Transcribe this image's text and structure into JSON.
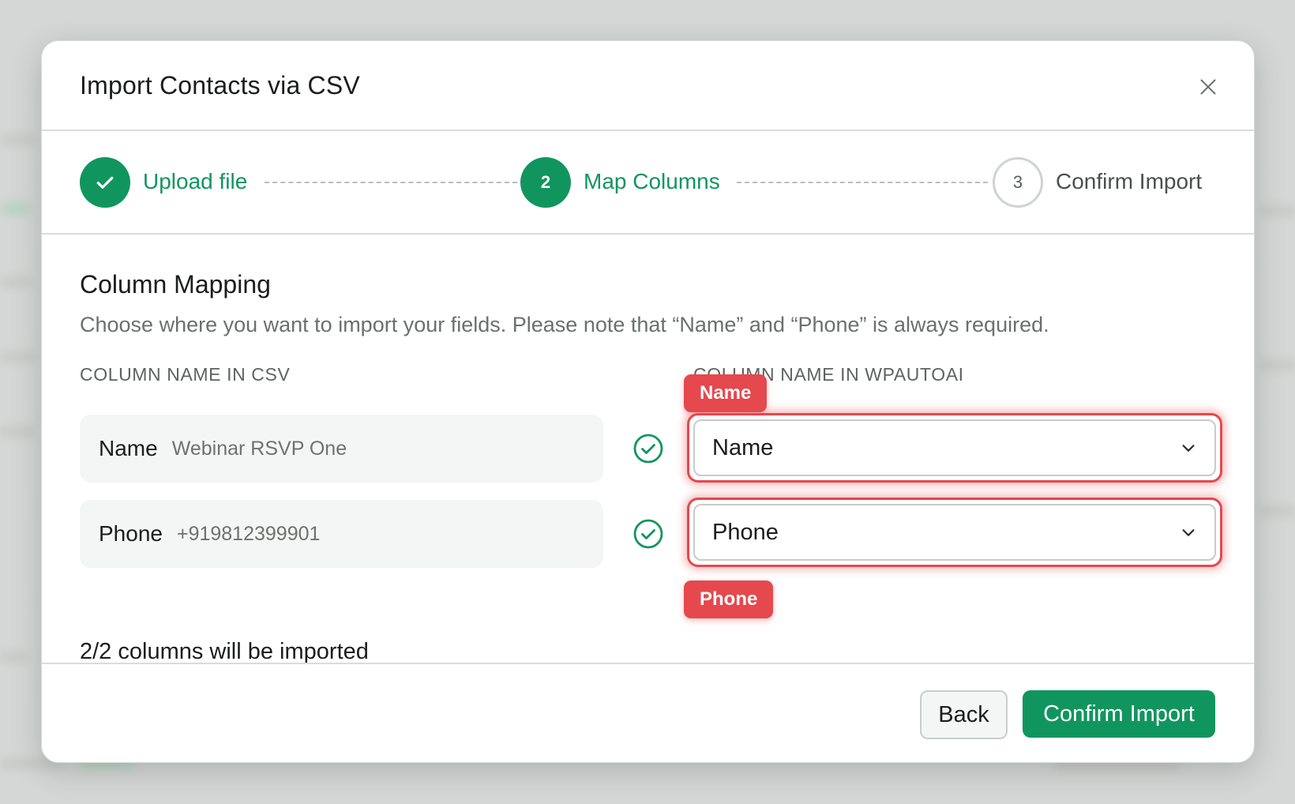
{
  "modal": {
    "title": "Import Contacts via CSV"
  },
  "steps": [
    {
      "number": "1",
      "label": "Upload file",
      "status": "done"
    },
    {
      "number": "2",
      "label": "Map Columns",
      "status": "active"
    },
    {
      "number": "3",
      "label": "Confirm Import",
      "status": "todo"
    }
  ],
  "mapping": {
    "title": "Column Mapping",
    "description": "Choose where you want to import your fields. Please note that “Name” and “Phone” is always required.",
    "csv_header": "COLUMN NAME IN CSV",
    "target_header": "COLUMN NAME IN WPAUTOAI",
    "rows": [
      {
        "csv_column": "Name",
        "sample": "Webinar RSVP One",
        "selected": "Name",
        "tag": "Name"
      },
      {
        "csv_column": "Phone",
        "sample": "+919812399901",
        "selected": "Phone",
        "tag": "Phone"
      }
    ],
    "summary": "2/2 columns will be imported"
  },
  "footer": {
    "back_label": "Back",
    "confirm_label": "Confirm Import"
  },
  "colors": {
    "accent": "#11955f",
    "error": "#e5484d"
  }
}
